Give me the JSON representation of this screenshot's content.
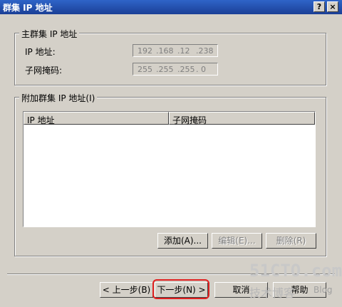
{
  "window": {
    "title": "群集 IP 地址",
    "help_glyph": "?",
    "close_glyph": "×"
  },
  "primary": {
    "legend": "主群集 IP 地址",
    "ip_label": "IP 地址:",
    "ip_octets": [
      "192",
      ".168",
      ".12",
      ".238"
    ],
    "mask_label": "子网掩码:",
    "mask_octets": [
      "255",
      ".255",
      ".255",
      ". 0"
    ]
  },
  "additional": {
    "legend": "附加群集 IP 地址(I)",
    "columns": [
      "IP 地址",
      "子网掩码"
    ],
    "add_label": "添加(A)...",
    "edit_label": "编辑(E)...",
    "delete_label": "删除(R)"
  },
  "footer": {
    "back_label": "< 上一步(B)",
    "next_label": "下一步(N) >",
    "cancel_label": "取消",
    "help_label": "帮助"
  },
  "watermark": {
    "site": "51CTO.com",
    "blog_cn": "技术博客",
    "blog_en": "Blog"
  }
}
